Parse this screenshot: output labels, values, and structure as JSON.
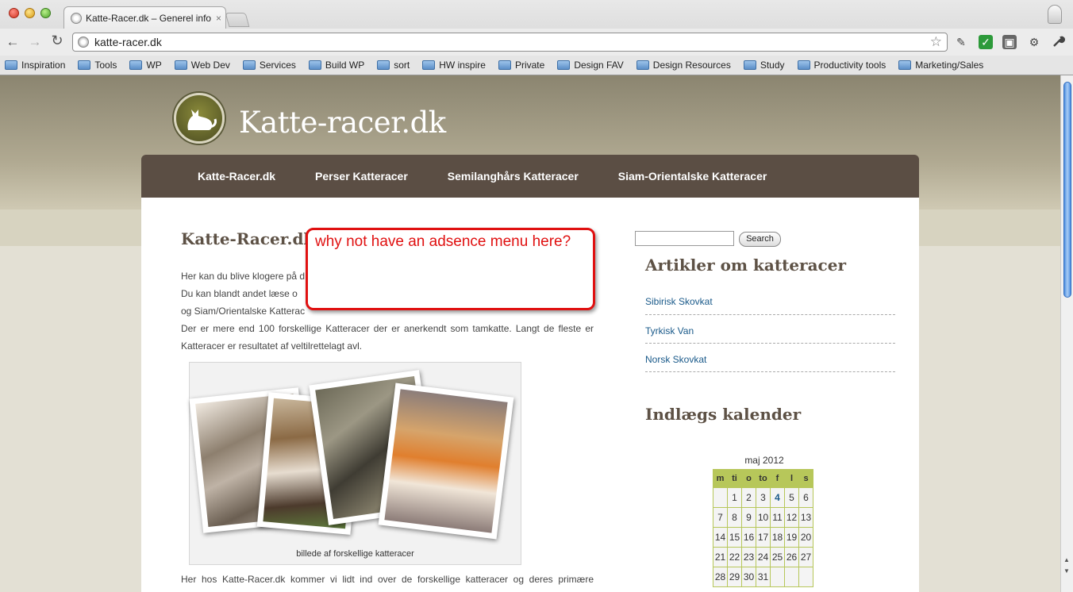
{
  "browser": {
    "tab_title": "Katte-Racer.dk – Generel info",
    "tab_close": "×",
    "url": "katte-racer.dk",
    "bookmarks": [
      "Inspiration",
      "Tools",
      "WP",
      "Web Dev",
      "Services",
      "Build WP",
      "sort",
      "HW inspire",
      "Private",
      "Design FAV",
      "Design Resources",
      "Study",
      "Productivity tools",
      "Marketing/Sales"
    ],
    "icons": {
      "back": "←",
      "forward": "→",
      "reload": "↻",
      "star": "☆",
      "wrench": "🔧",
      "gear": "⚙"
    }
  },
  "site": {
    "title": "Katte-racer.dk",
    "nav": [
      "Katte-Racer.dk",
      "Perser Katteracer",
      "Semilanghårs Katteracer",
      "Siam-Orientalske Katteracer"
    ]
  },
  "post": {
    "title": "Katte-Racer.dk",
    "line1": "Her kan du blive klogere på d",
    "line2": "Du kan blandt andet læse o",
    "line3": "og Siam/Orientalske Katterac",
    "para2": "Der er mere end 100 forskellige Katteracer der er anerkendt som tamkatte. Langt de fleste er Katteracer er resultatet af veltilrettelagt avl.",
    "caption": "billede af forskellige katteracer",
    "footer": "Her hos Katte-Racer.dk kommer vi lidt ind over de forskellige katteracer og deres primære"
  },
  "sidebar": {
    "search_button": "Search",
    "articles_title": "Artikler om katteracer",
    "articles": [
      "Sibirisk Skovkat",
      "Tyrkisk Van",
      "Norsk Skovkat"
    ],
    "calendar_title": "Indlægs kalender",
    "calendar_caption": "maj 2012",
    "calendar_headers": [
      "m",
      "ti",
      "o",
      "to",
      "f",
      "l",
      "s"
    ],
    "calendar_rows": [
      [
        "",
        "1",
        "2",
        "3",
        "4",
        "5",
        "6"
      ],
      [
        "7",
        "8",
        "9",
        "10",
        "11",
        "12",
        "13"
      ],
      [
        "14",
        "15",
        "16",
        "17",
        "18",
        "19",
        "20"
      ],
      [
        "21",
        "22",
        "23",
        "24",
        "25",
        "26",
        "27"
      ],
      [
        "28",
        "29",
        "30",
        "31",
        "",
        "",
        ""
      ]
    ],
    "today": "4"
  },
  "annotation": {
    "text": "why not have an adsence menu here?"
  },
  "colors": {
    "nav_bg": "#5b4e44",
    "annotation_red": "#e01010",
    "calendar_green": "#b7c75a",
    "link_blue": "#1a5a8a"
  }
}
